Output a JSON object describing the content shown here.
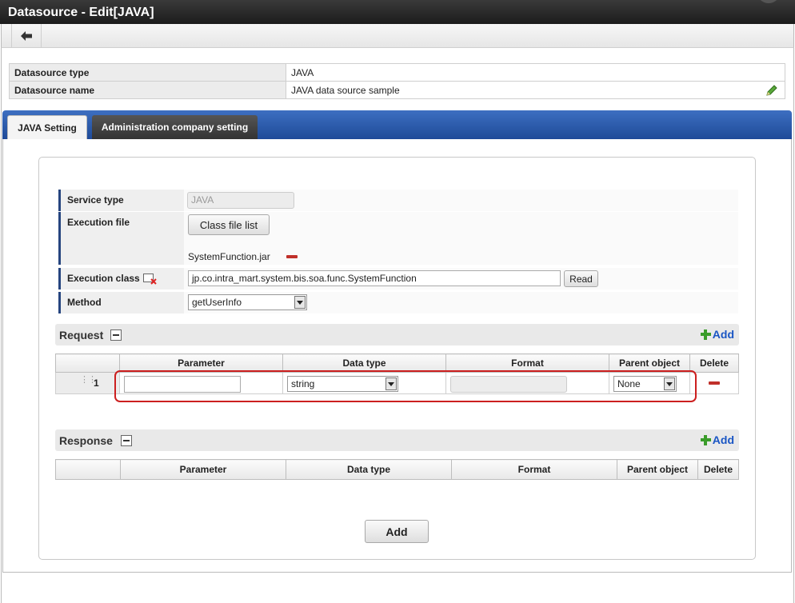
{
  "window": {
    "title": "Datasource - Edit[JAVA]"
  },
  "info": {
    "type_label": "Datasource type",
    "type_value": "JAVA",
    "name_label": "Datasource name",
    "name_value": "JAVA data source sample"
  },
  "tabs": [
    {
      "label": "JAVA Setting",
      "active": true
    },
    {
      "label": "Administration company setting",
      "active": false
    }
  ],
  "form": {
    "service_type_label": "Service type",
    "service_type_value": "JAVA",
    "execution_file_label": "Execution file",
    "class_file_list_button": "Class file list",
    "execution_file_name": "SystemFunction.jar",
    "execution_class_label": "Execution class",
    "execution_class_value": "jp.co.intra_mart.system.bis.soa.func.SystemFunction",
    "read_button": "Read",
    "method_label": "Method",
    "method_value": "getUserInfo"
  },
  "request": {
    "title": "Request",
    "add_label": "Add",
    "columns": [
      "Parameter",
      "Data type",
      "Format",
      "Parent object",
      "Delete"
    ],
    "rows": [
      {
        "index": "1",
        "parameter": "",
        "data_type": "string",
        "format": "",
        "parent_object": "None"
      }
    ]
  },
  "response": {
    "title": "Response",
    "add_label": "Add",
    "columns": [
      "Parameter",
      "Data type",
      "Format",
      "Parent object",
      "Delete"
    ]
  },
  "footer": {
    "add_button": "Add"
  },
  "colors": {
    "tab_bar": "#1e4a98",
    "highlight": "#cc1f1f",
    "add_link": "#1a56c4",
    "delete_icon": "#c0302a"
  }
}
